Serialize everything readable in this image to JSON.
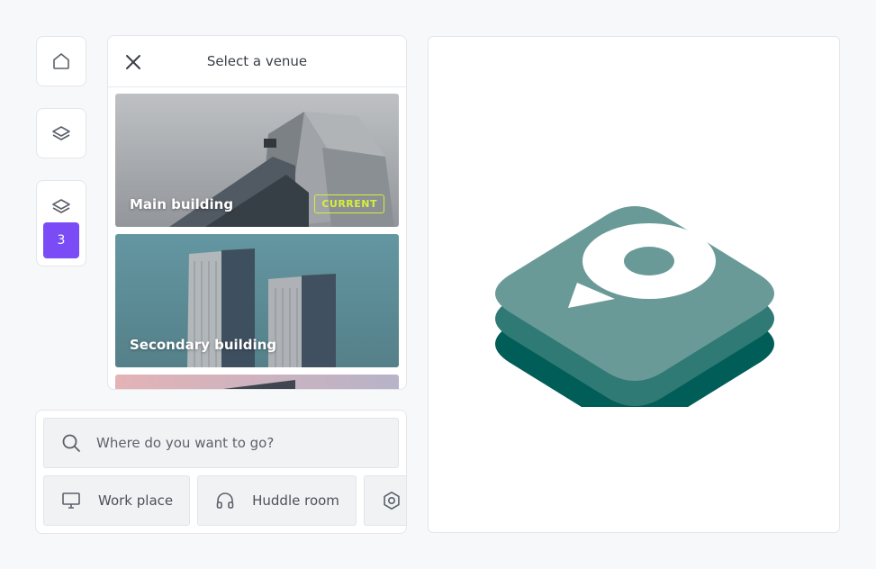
{
  "rail": {
    "home_icon": "home-icon",
    "layers_icon": "layers-icon",
    "floor_count": "3"
  },
  "venue_panel": {
    "title": "Select a venue",
    "close_icon": "close-icon",
    "venues": [
      {
        "name": "Main building",
        "tag": "CURRENT"
      },
      {
        "name": "Secondary building"
      },
      {
        "name": ""
      }
    ]
  },
  "search": {
    "placeholder": "Where do you want to go?",
    "icon": "search-icon"
  },
  "categories": [
    {
      "label": "Work place",
      "icon": "monitor-icon"
    },
    {
      "label": "Huddle room",
      "icon": "headphones-icon"
    },
    {
      "label": "",
      "icon": "gear-icon"
    }
  ],
  "colors": {
    "accent": "#7b4cf5",
    "tag": "#d8ee3a",
    "logo_top": "#6a9a98",
    "logo_mid": "#2f7a75",
    "logo_bottom": "#015d58"
  }
}
